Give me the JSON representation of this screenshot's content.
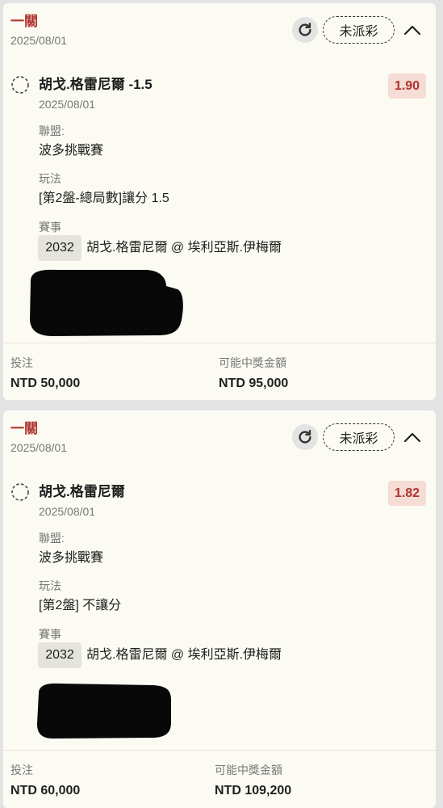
{
  "bets": [
    {
      "bet_type": "一關",
      "date": "2025/08/01",
      "status": "未派彩",
      "selection": "胡戈.格雷尼爾 -1.5",
      "selection_date": "2025/08/01",
      "odds": "1.90",
      "league_label": "聯盟:",
      "league": "波多挑戰賽",
      "market_label": "玩法",
      "market": "[第2盤-總局數]讓分 1.5",
      "event_label": "賽事",
      "event_id": "2032",
      "event_name": "胡戈.格雷尼爾 @ 埃利亞斯.伊梅爾",
      "stake_label": "投注",
      "stake": "NTD 50,000",
      "payout_label": "可能中獎金額",
      "payout": "NTD 95,000"
    },
    {
      "bet_type": "一關",
      "date": "2025/08/01",
      "status": "未派彩",
      "selection": "胡戈.格雷尼爾",
      "selection_date": "2025/08/01",
      "odds": "1.82",
      "league_label": "聯盟:",
      "league": "波多挑戰賽",
      "market_label": "玩法",
      "market": "[第2盤] 不讓分",
      "event_label": "賽事",
      "event_id": "2032",
      "event_name": "胡戈.格雷尼爾 @ 埃利亞斯.伊梅爾",
      "stake_label": "投注",
      "stake": "NTD 60,000",
      "payout_label": "可能中獎金額",
      "payout": "NTD 109,200"
    }
  ],
  "colors": {
    "accent_red": "#b0342f",
    "odds_badge_bg": "#f5dcd5",
    "card_bg": "#fcfbf3",
    "page_bg": "#e3e3e3"
  },
  "icons": {
    "refresh": "refresh-icon",
    "collapse": "chevron-up-icon",
    "selection": "dashed-circle-icon"
  }
}
